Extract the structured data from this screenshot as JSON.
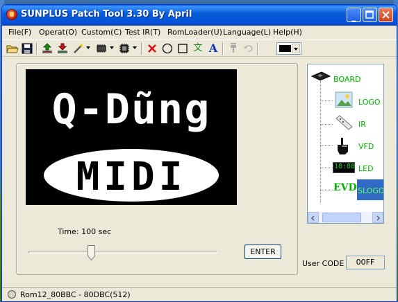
{
  "window": {
    "title": "SUNPLUS Patch Tool 3.30 By April"
  },
  "menu": [
    "File(F)",
    "Operat(O)",
    "Custom(C)",
    "Test IR(T)",
    "RomLoader(U)",
    "Language(L)",
    "Help(H)"
  ],
  "toolbar": {
    "icons": [
      "open-folder-icon",
      "save-icon",
      "upload-icon",
      "download-icon",
      "wand-icon",
      "chip-icon",
      "chip-settings-icon",
      "delete-icon",
      "circle-icon",
      "rectangle-icon",
      "text-wen-icon",
      "text-a-icon",
      "paint-icon",
      "undo-icon"
    ],
    "text_wen": "文",
    "text_a": "A",
    "selected_color": "#000000"
  },
  "preview": {
    "line1": "Q-Dũng",
    "line2": "MIDI"
  },
  "time_label": "Time: 100 sec",
  "slider": {
    "value_fraction": 0.33
  },
  "enter_label": "ENTER",
  "tree": {
    "nodes": [
      {
        "label": "BOARD",
        "icon": "board-icon"
      },
      {
        "label": "LOGO",
        "icon": "picture-icon"
      },
      {
        "label": "IR",
        "icon": "remote-icon"
      },
      {
        "label": "VFD",
        "icon": "hand-icon"
      },
      {
        "label": "LED",
        "icon": "led-display-icon",
        "display": "18:88"
      },
      {
        "label": "SLOGO",
        "icon": "evd-icon",
        "icon_text": "EVD",
        "selected": true
      }
    ]
  },
  "user_code": {
    "label": "User CODE",
    "value": "00FF"
  },
  "status": {
    "text": "Rom12_80BBC - 80DBC(512)"
  },
  "colors": {
    "accent": "#0a5ed7",
    "node_text": "#00b000",
    "selection": "#316ac5"
  }
}
